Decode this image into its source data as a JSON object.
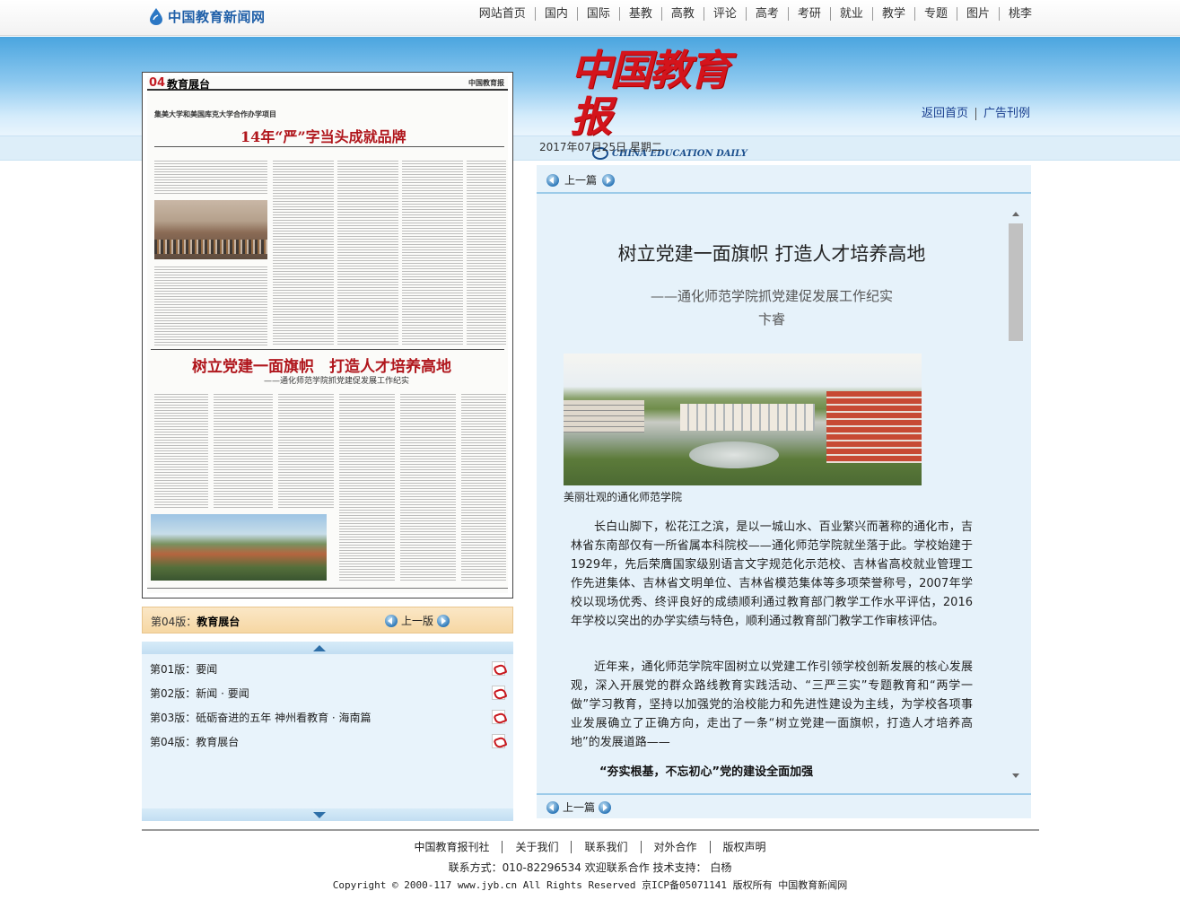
{
  "site": {
    "logo_text": "中国教育新闻网"
  },
  "topnav": [
    "网站首页",
    "国内",
    "国际",
    "基教",
    "高教",
    "评论",
    "高考",
    "考研",
    "就业",
    "教学",
    "专题",
    "图片",
    "桃李"
  ],
  "banner": {
    "paper_name": "中国教育报",
    "paper_name_en": "CHINA EDUCATION DAILY",
    "links": [
      "返回首页",
      "广告刊例"
    ],
    "date": "2017年07月25日 星期二"
  },
  "thumbnail": {
    "page_no": "04",
    "page_name": "教育展台",
    "masthead": "中国教育报",
    "sub_headline": "集美大学和美国库克大学合作办学项目",
    "headline_1": "14年“严”字当头成就品牌",
    "headline_2": "树立党建一面旗帜　打造人才培养高地",
    "headline_2_sub": "——通化师范学院抓党建促发展工作纪实"
  },
  "edition_bar": {
    "label_prefix": "第04版：",
    "label_name": "教育展台",
    "prev": "上一版"
  },
  "editions": [
    {
      "label": "第01版：要闻"
    },
    {
      "label": "第02版：新闻 · 要闻"
    },
    {
      "label": "第03版：砥砺奋进的五年 神州看教育 · 海南篇"
    },
    {
      "label": "第04版：教育展台"
    }
  ],
  "article": {
    "prev_top": "上一篇",
    "prev_bottom": "上一篇",
    "title": "树立党建一面旗帜  打造人才培养高地",
    "subtitle": "——通化师范学院抓党建促发展工作纪实",
    "author": "卞睿",
    "photo_caption": "美丽壮观的通化师范学院",
    "paragraphs": [
      "长白山脚下，松花江之滨，是以一城山水、百业繁兴而著称的通化市，吉林省东南部仅有一所省属本科院校——通化师范学院就坐落于此。学校始建于1929年，先后荣膺国家级别语言文字规范化示范校、吉林省高校就业管理工作先进集体、吉林省文明单位、吉林省模范集体等多项荣誉称号，2007年学校以现场优秀、终评良好的成绩顺利通过教育部门教学工作水平评估，2016年学校以突出的办学实绩与特色，顺利通过教育部门教学工作审核评估。",
      "近年来，通化师范学院牢固树立以党建工作引领学校创新发展的核心发展观，深入开展党的群众路线教育实践活动、“三严三实”专题教育和“两学一做”学习教育，坚持以加强党的治校能力和先进性建设为主线，为学校各项事业发展确立了正确方向，走出了一条“树立党建一面旗帜，打造人才培养高地”的发展道路——"
    ],
    "section_heading": "“夯实根基，不忘初心”党的建设全面加强"
  },
  "footer": {
    "links": [
      "中国教育报刊社",
      "关于我们",
      "联系我们",
      "对外合作",
      "版权声明"
    ],
    "contact": "联系方式：010-82296534 欢迎联系合作 技术支持： 白杨",
    "copyright": "Copyright © 2000-117 www.jyb.cn All Rights Reserved 京ICP备05071141 版权所有 中国教育新闻网"
  }
}
